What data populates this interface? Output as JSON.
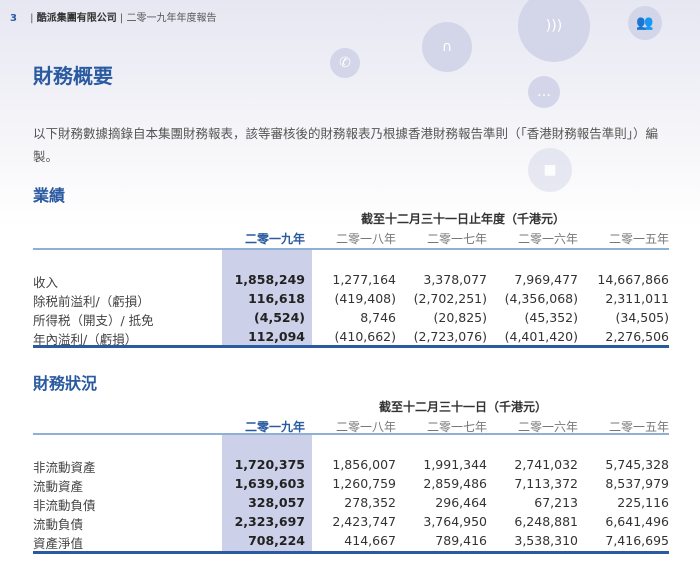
{
  "header": {
    "page_number": "3",
    "company": "酷派集團有限公司",
    "report": "二零一九年年度報告"
  },
  "title": "財務概要",
  "intro": "以下財務數據摘錄自本集團財務報表，該等審核後的財務報表乃根據香港財務報告準則（「香港財務報告準則」）編製。",
  "years": [
    "二零一九年",
    "二零一八年",
    "二零一七年",
    "二零一六年",
    "二零一五年"
  ],
  "results": {
    "heading": "業績",
    "caption": "截至十二月三十一日止年度（千港元）",
    "rows": [
      {
        "label": "收入",
        "values": [
          "1,858,249",
          "1,277,164",
          "3,378,077",
          "7,969,477",
          "14,667,866"
        ]
      },
      {
        "label": "除税前溢利/（虧損）",
        "values": [
          "116,618",
          "(419,408)",
          "(2,702,251)",
          "(4,356,068)",
          "2,311,011"
        ]
      },
      {
        "label": "所得税（開支）/ 抵免",
        "values": [
          "(4,524)",
          "8,746",
          "(20,825)",
          "(45,352)",
          "(34,505)"
        ]
      },
      {
        "label": "年內溢利/（虧損）",
        "values": [
          "112,094",
          "(410,662)",
          "(2,723,076)",
          "(4,401,420)",
          "2,276,506"
        ]
      }
    ]
  },
  "financial_position": {
    "heading": "財務狀況",
    "caption": "截至十二月三十一日（千港元）",
    "rows": [
      {
        "label": "非流動資產",
        "values": [
          "1,720,375",
          "1,856,007",
          "1,991,344",
          "2,741,032",
          "5,745,328"
        ]
      },
      {
        "label": "流動資產",
        "values": [
          "1,639,603",
          "1,260,759",
          "2,859,486",
          "7,113,372",
          "8,537,979"
        ]
      },
      {
        "label": "非流動負債",
        "values": [
          "328,057",
          "278,352",
          "296,464",
          "67,213",
          "225,116"
        ]
      },
      {
        "label": "流動負債",
        "values": [
          "2,323,697",
          "2,423,747",
          "3,764,950",
          "6,248,881",
          "6,641,496"
        ]
      },
      {
        "label": "資產淨值",
        "values": [
          "708,224",
          "414,667",
          "789,416",
          "3,538,310",
          "7,416,695"
        ]
      }
    ]
  },
  "colors": {
    "accent": "#2a5aa0",
    "highlight": "#ccd0e8"
  }
}
